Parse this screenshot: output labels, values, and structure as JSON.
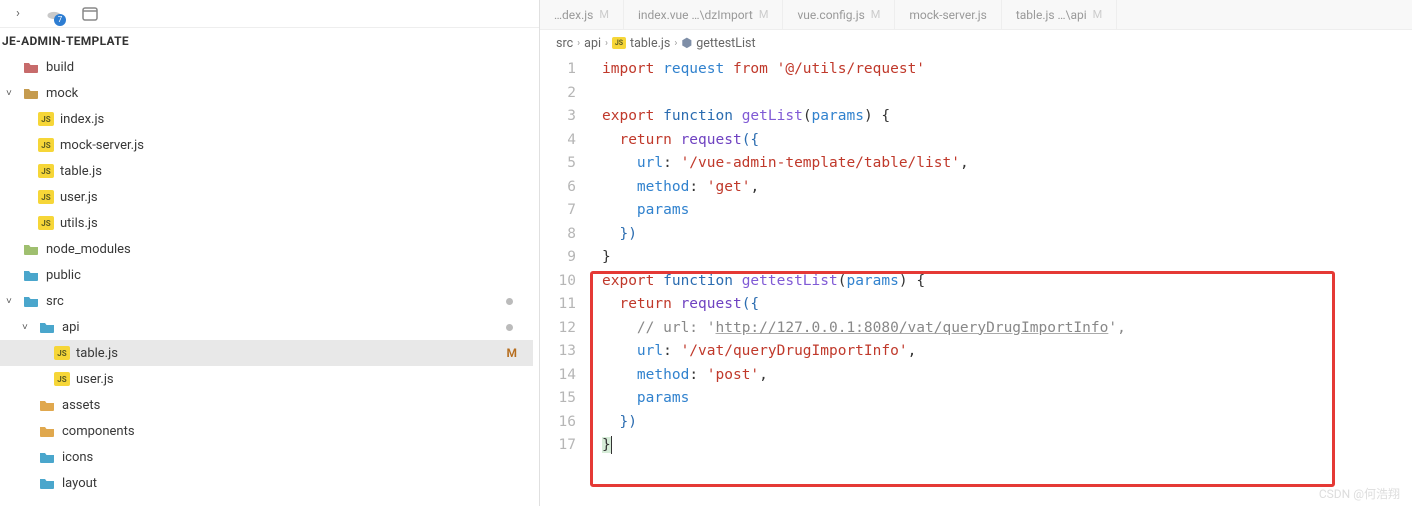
{
  "project": {
    "title": "JE-ADMIN-TEMPLATE"
  },
  "tree": {
    "items": [
      {
        "label": "build",
        "type": "folder",
        "color": "#c76b6b",
        "indent": 0,
        "chevron": ""
      },
      {
        "label": "mock",
        "type": "folder",
        "color": "#c59b4f",
        "indent": 0,
        "chevron": "˅"
      },
      {
        "label": "index.js",
        "type": "js",
        "indent": 1
      },
      {
        "label": "mock-server.js",
        "type": "js",
        "indent": 1
      },
      {
        "label": "table.js",
        "type": "js",
        "indent": 1
      },
      {
        "label": "user.js",
        "type": "js",
        "indent": 1
      },
      {
        "label": "utils.js",
        "type": "js",
        "indent": 1
      },
      {
        "label": "node_modules",
        "type": "folder",
        "color": "#9fbf6f",
        "indent": 0,
        "chevron": ""
      },
      {
        "label": "public",
        "type": "folder",
        "color": "#4aa6cc",
        "indent": 0,
        "chevron": ""
      },
      {
        "label": "src",
        "type": "folder",
        "color": "#4aa6cc",
        "indent": 0,
        "chevron": "˅",
        "dot": true
      },
      {
        "label": "api",
        "type": "folder",
        "color": "#4aa6cc",
        "indent": 1,
        "chevron": "˅",
        "dot": true
      },
      {
        "label": "table.js",
        "type": "js",
        "indent": 2,
        "active": true,
        "badge": "M"
      },
      {
        "label": "user.js",
        "type": "js",
        "indent": 2
      },
      {
        "label": "assets",
        "type": "folder",
        "color": "#e0a84e",
        "indent": 1,
        "chevron": ""
      },
      {
        "label": "components",
        "type": "folder",
        "color": "#e0a84e",
        "indent": 1,
        "chevron": ""
      },
      {
        "label": "icons",
        "type": "folder",
        "color": "#4aa6cc",
        "indent": 1,
        "chevron": ""
      },
      {
        "label": "layout",
        "type": "folder",
        "color": "#4aa6cc",
        "indent": 1,
        "chevron": ""
      }
    ]
  },
  "tabs": [
    {
      "label": "…dex.js",
      "mod": "M"
    },
    {
      "label": "index.vue …\\dzImport",
      "mod": "M"
    },
    {
      "label": "vue.config.js",
      "mod": "M"
    },
    {
      "label": "mock-server.js",
      "mod": ""
    },
    {
      "label": "table.js …\\api",
      "mod": "M"
    }
  ],
  "breadcrumb": {
    "p0": "src",
    "p1": "api",
    "p2": "table.js",
    "p3": "gettestList"
  },
  "code": {
    "lines": [
      "1",
      "2",
      "3",
      "4",
      "5",
      "6",
      "7",
      "8",
      "9",
      "10",
      "11",
      "12",
      "13",
      "14",
      "15",
      "16",
      "17"
    ],
    "l1_import": "import",
    "l1_request": " request ",
    "l1_from": "from",
    "l1_str": " '@/utils/request'",
    "l3_export": "export",
    "l3_func": " function",
    "l3_name": " getList",
    "l3_open": "(",
    "l3_param": "params",
    "l3_close": ") {",
    "l4_return": "  return",
    "l4_req": " request",
    "l4_open": "({",
    "l5_url_k": "    url",
    "l5_colon": ": ",
    "l5_url_v": "'/vue-admin-template/table/list'",
    "l5_comma": ",",
    "l6_method_k": "    method",
    "l6_method_v": "'get'",
    "l7_params": "    params",
    "l8_close": "  })",
    "l9_brace": "}",
    "l10_export": "export",
    "l10_func": " function",
    "l10_name": " gettestList",
    "l10_open": "(",
    "l10_param": "params",
    "l10_close": ") {",
    "l11_return": "  return",
    "l11_req": " request",
    "l11_open": "({",
    "l12_comment_a": "    // url: '",
    "l12_comment_b": "http://127.0.0.1:8080/vat/queryDrugImportInfo",
    "l12_comment_c": "',",
    "l13_url_k": "    url",
    "l13_url_v": "'/vat/queryDrugImportInfo'",
    "l14_method_k": "    method",
    "l14_method_v": "'post'",
    "l15_params": "    params",
    "l16_close": "  })",
    "l17_brace": "}"
  },
  "watermark": "CSDN @何浩翔"
}
